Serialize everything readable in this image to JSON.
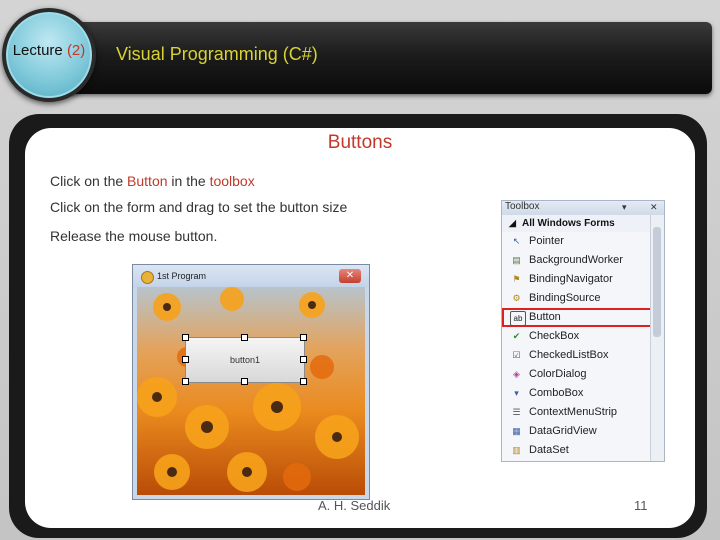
{
  "header": {
    "lecture_label": "Lecture",
    "lecture_number": "(2)",
    "course_title": "Visual Programming (C#)"
  },
  "slide": {
    "title": "Buttons",
    "bullet1": {
      "part1": "Click on the ",
      "button_word": "Button",
      "part2": " in the ",
      "toolbox_word": "toolbox"
    },
    "bullet2": "Click on the form and drag to set the button size",
    "bullet3": "Release the mouse button."
  },
  "form_preview": {
    "window_title": "1st Program",
    "close_glyph": "✕",
    "button_text": "button1"
  },
  "toolbox": {
    "title": "Toolbox",
    "pin_glyph": "▾",
    "close_glyph": "✕",
    "group_toggle": "◢",
    "group_label": "All Windows Forms",
    "items": [
      {
        "label": "Pointer",
        "icon": "pointer-icon",
        "glyph": "↖"
      },
      {
        "label": "BackgroundWorker",
        "icon": "background-worker-icon",
        "glyph": "▤"
      },
      {
        "label": "BindingNavigator",
        "icon": "binding-navigator-icon",
        "glyph": "⚑"
      },
      {
        "label": "BindingSource",
        "icon": "binding-source-icon",
        "glyph": "⚙"
      },
      {
        "label": "Button",
        "icon": "button-icon",
        "glyph": "ab"
      },
      {
        "label": "CheckBox",
        "icon": "checkbox-icon",
        "glyph": "✔"
      },
      {
        "label": "CheckedListBox",
        "icon": "checked-listbox-icon",
        "glyph": "☑"
      },
      {
        "label": "ColorDialog",
        "icon": "color-dialog-icon",
        "glyph": "◈"
      },
      {
        "label": "ComboBox",
        "icon": "combobox-icon",
        "glyph": "▾"
      },
      {
        "label": "ContextMenuStrip",
        "icon": "context-menu-strip-icon",
        "glyph": "☰"
      },
      {
        "label": "DataGridView",
        "icon": "datagridview-icon",
        "glyph": "▦"
      },
      {
        "label": "DataSet",
        "icon": "dataset-icon",
        "glyph": "▥"
      }
    ]
  },
  "footer": {
    "author": "A. H. Seddik",
    "page_number": "11"
  },
  "colors": {
    "accent_red": "#c0392b",
    "title_yellow": "#d9d234",
    "selection_red": "#e02020"
  }
}
